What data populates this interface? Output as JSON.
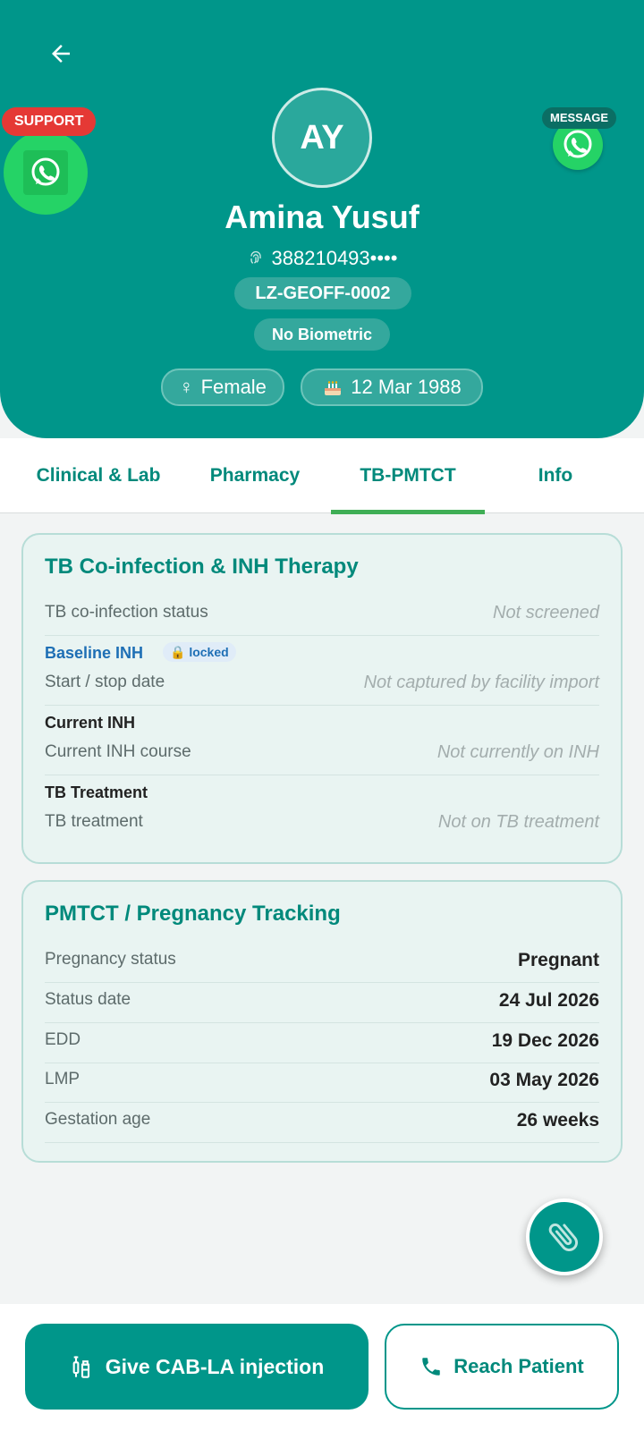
{
  "header": {
    "support_label": "SUPPORT",
    "message_label": "MESSAGE",
    "avatar_initials": "AY",
    "patient_name": "Amina Yusuf",
    "patient_id": "388210493••••",
    "facility_code": "LZ-GEOFF-0002",
    "biometric_status": "No Biometric",
    "gender": "Female",
    "gender_icon": "female-symbol",
    "dob": "12 Mar 1988",
    "dob_icon": "birthday-cake",
    "accent_color": "#00968a"
  },
  "tabs": [
    {
      "label": "Clinical & Lab",
      "active": false
    },
    {
      "label": "Pharmacy",
      "active": false
    },
    {
      "label": "TB-PMTCT",
      "active": true
    },
    {
      "label": "Info",
      "active": false
    }
  ],
  "tb_card": {
    "title": "TB Co-infection & INH Therapy",
    "coinfection_label": "TB co-infection status",
    "coinfection_value": "Not screened",
    "baseline_heading": "Baseline INH",
    "baseline_lock": "locked",
    "baseline_label": "Start / stop date",
    "baseline_value": "Not captured by facility import",
    "current_heading": "Current INH",
    "current_label": "Current INH course",
    "current_value": "Not currently on INH",
    "treatment_heading": "TB Treatment",
    "treatment_label": "TB treatment",
    "treatment_value": "Not on TB treatment"
  },
  "pmtct_card": {
    "title": "PMTCT / Pregnancy Tracking",
    "rows": [
      {
        "label": "Pregnancy status",
        "value": "Pregnant"
      },
      {
        "label": "Status date",
        "value": "24 Jul 2026"
      },
      {
        "label": "EDD",
        "value": "19 Dec 2026"
      },
      {
        "label": "LMP",
        "value": "03 May 2026"
      },
      {
        "label": "Gestation age",
        "value": "26 weeks"
      }
    ]
  },
  "actions": {
    "primary_label": "Give CAB-LA injection",
    "secondary_label": "Reach Patient"
  }
}
